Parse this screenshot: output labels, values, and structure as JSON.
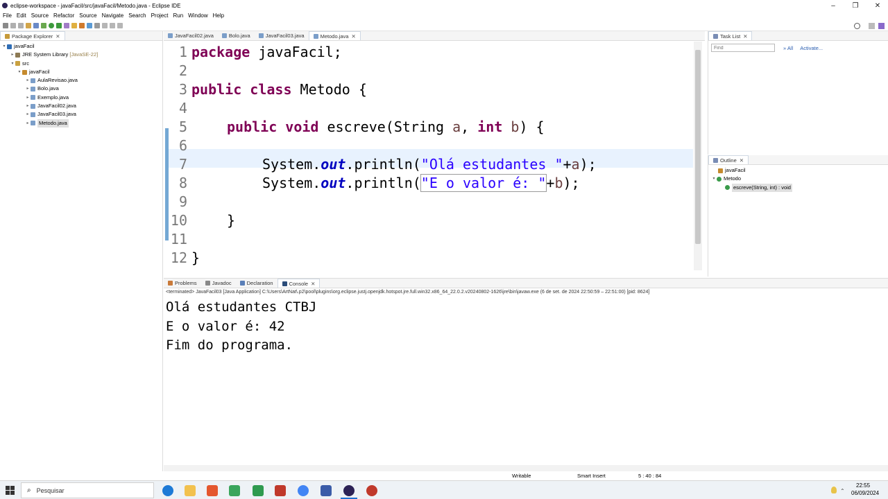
{
  "window": {
    "title": "eclipse-workspace - javaFacil/src/javaFacil/Metodo.java - Eclipse IDE",
    "minimize": "–",
    "maximize": "❐",
    "close": "✕"
  },
  "menu": [
    "File",
    "Edit",
    "Source",
    "Refactor",
    "Source",
    "Navigate",
    "Search",
    "Project",
    "Run",
    "Window",
    "Help"
  ],
  "package_explorer": {
    "tab": "Package Explorer",
    "tree": [
      {
        "label": "javaFacil",
        "suffix": ""
      },
      {
        "label": "JRE System Library",
        "suffix": "[JavaSE-22]"
      },
      {
        "label": "src",
        "suffix": ""
      },
      {
        "label": "javaFacil",
        "suffix": ""
      },
      {
        "label": "AulaRevisao.java",
        "suffix": ""
      },
      {
        "label": "Bolo.java",
        "suffix": ""
      },
      {
        "label": "Exemplo.java",
        "suffix": ""
      },
      {
        "label": "JavaFacil02.java",
        "suffix": ""
      },
      {
        "label": "JavaFacil03.java",
        "suffix": ""
      },
      {
        "label": "Metodo.java",
        "suffix": ""
      }
    ]
  },
  "editor": {
    "tabs": [
      "JavaFacil02.java",
      "Bolo.java",
      "JavaFacil03.java",
      "Metodo.java"
    ],
    "active_tab": "Metodo.java",
    "line_numbers": [
      "1",
      "2",
      "3",
      "4",
      "5",
      "6",
      "7",
      "8",
      "9",
      "10",
      "11",
      "12"
    ],
    "code": {
      "l1_kw": "package",
      "l1_rest": " javaFacil;",
      "l3_kw": "public class",
      "l3_rest": " Metodo {",
      "l5_kw1": "public void",
      "l5_a": " escreve(String ",
      "l5_p1": "a",
      "l5_b": ", ",
      "l5_kw2": "int",
      "l5_c": " ",
      "l5_p2": "b",
      "l5_d": ") {",
      "l7_a": "System.",
      "l7_fld": "out",
      "l7_b": ".println(",
      "l7_str": "\"Olá estudantes \"",
      "l7_c": "+",
      "l7_p": "a",
      "l7_d": ");",
      "l8_a": "System.",
      "l8_fld": "out",
      "l8_b": ".println(",
      "l8_str": "\"E o valor é: \"",
      "l8_c": "+",
      "l8_p": "b",
      "l8_d": ");",
      "l10": "}",
      "l12": "}"
    }
  },
  "task_list": {
    "tab": "Task List",
    "find_placeholder": "Find",
    "all": "All",
    "activate": "Activate..."
  },
  "outline": {
    "tab": "Outline",
    "items": [
      "javaFacil",
      "Metodo",
      "escreve(String, int) : void"
    ]
  },
  "bottom": {
    "tabs": [
      "Problems",
      "Javadoc",
      "Declaration",
      "Console"
    ],
    "active_tab": "Console",
    "terminated": "<terminated> JavaFacil03 [Java Application] C:\\Users\\ArtNat\\.p2\\pool\\plugins\\org.eclipse.justj.openjdk.hotspot.jre.full.win32.x86_64_22.0.2.v20240802-1626\\jre\\bin\\javaw.exe  (6 de set. de 2024 22:50:59 – 22:51:00) [pid: 8624]",
    "output": [
      "Olá estudantes CTBJ",
      "E o valor é: 42",
      "Fim do programa."
    ]
  },
  "status": {
    "writable": "Writable",
    "insert": "Smart Insert",
    "position": "5 : 40 : 84"
  },
  "taskbar": {
    "search_placeholder": "Pesquisar",
    "time": "22:55",
    "date": "06/09/2024"
  }
}
